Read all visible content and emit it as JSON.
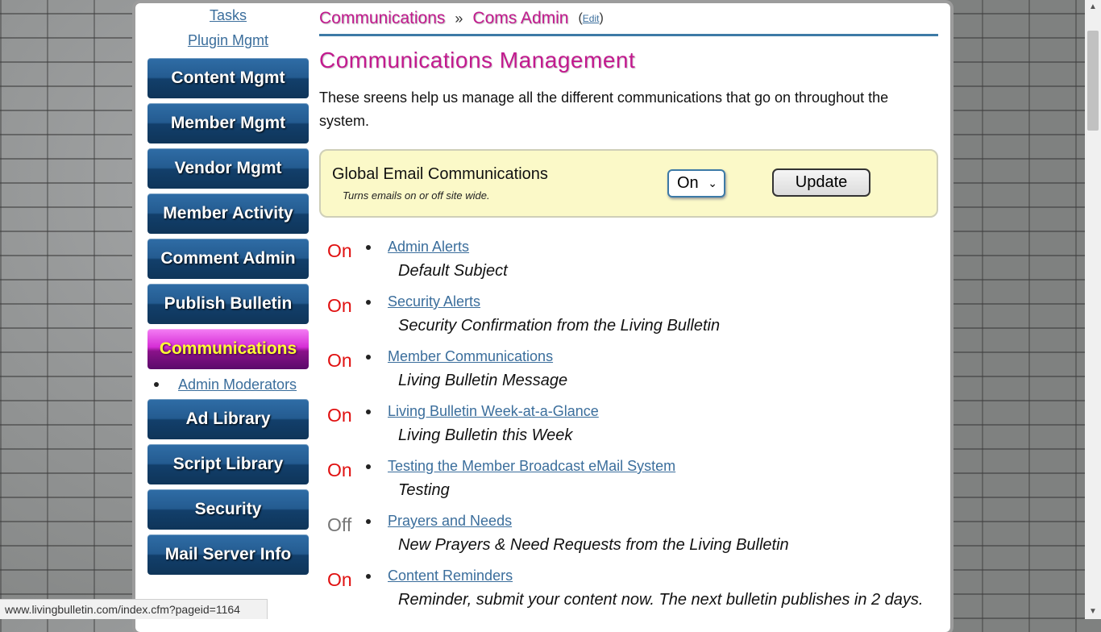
{
  "sidebar": {
    "top_links": [
      "Tasks",
      "Plugin Mgmt"
    ],
    "buttons_before": [
      "Content Mgmt",
      "Member Mgmt",
      "Vendor Mgmt",
      "Member Activity",
      "Comment Admin",
      "Publish Bulletin"
    ],
    "active": "Communications",
    "sub_item": "Admin Moderators",
    "buttons_after": [
      "Ad Library",
      "Script Library",
      "Security",
      "Mail Server Info"
    ]
  },
  "breadcrumb": {
    "first": "Communications",
    "separator": "»",
    "second": "Coms Admin",
    "edit_open": "(",
    "edit": "Edit",
    "edit_close": ")"
  },
  "page_title": "Communications Management",
  "intro": "These sreens help us manage all the different communications that go on throughout the system.",
  "global": {
    "label": "Global Email Communications",
    "sub": "Turns emails on or off site wide.",
    "select_value": "On",
    "update_label": "Update"
  },
  "items": [
    {
      "status": "On",
      "title": "Admin Alerts",
      "subject": "Default Subject"
    },
    {
      "status": "On",
      "title": "Security Alerts",
      "subject": "Security Confirmation from the Living Bulletin"
    },
    {
      "status": "On",
      "title": "Member Communications",
      "subject": "Living Bulletin Message"
    },
    {
      "status": "On",
      "title": "Living Bulletin Week-at-a-Glance",
      "subject": "Living Bulletin this Week"
    },
    {
      "status": "On",
      "title": "Testing the Member Broadcast eMail System",
      "subject": "Testing"
    },
    {
      "status": "Off",
      "title": "Prayers and Needs",
      "subject": "New Prayers & Need Requests from the Living Bulletin"
    },
    {
      "status": "On",
      "title": "Content Reminders",
      "subject": "Reminder, submit your content now. The next bulletin publishes in 2 days."
    }
  ],
  "status_bar": "www.livingbulletin.com/index.cfm?pageid=1164",
  "colors": {
    "accent": "#c21a8e",
    "link": "#3b6e9c",
    "on": "#e01010",
    "off": "#777777"
  }
}
